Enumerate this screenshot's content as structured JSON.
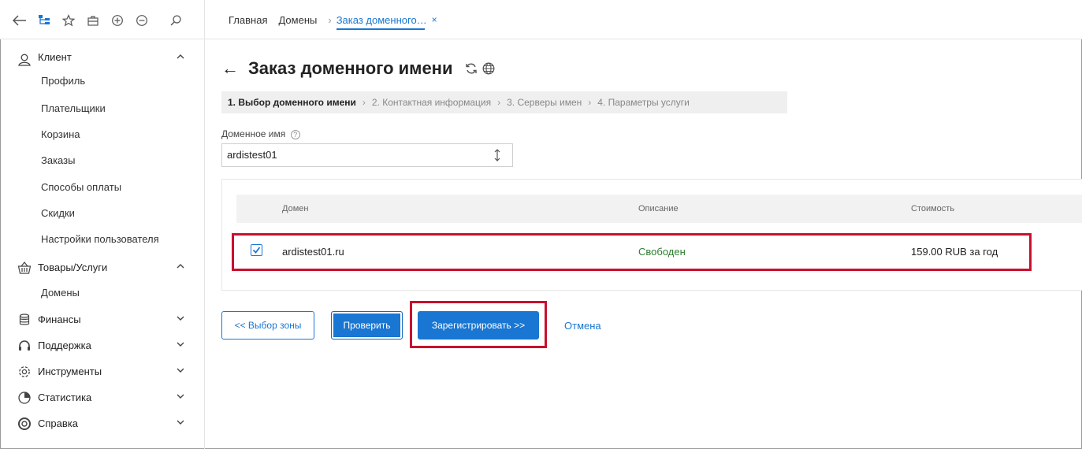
{
  "topbar": {
    "icons": [
      "back-arrow-icon",
      "tree-icon",
      "star-icon",
      "briefcase-icon",
      "zoom-in-icon",
      "zoom-out-icon",
      "search-icon"
    ],
    "tabs": [
      {
        "label": "Главная"
      },
      {
        "label": "Домены"
      },
      {
        "label": "Заказ доменного…",
        "active": true
      }
    ],
    "crumb_separator": "›",
    "close_glyph": "×"
  },
  "sidebar": {
    "groups": [
      {
        "label": "Клиент",
        "icon": "user-icon",
        "expanded": true,
        "items": [
          "Профиль",
          "Плательщики",
          "Корзина",
          "Заказы",
          "Способы оплаты",
          "Скидки",
          "Настройки пользователя"
        ]
      },
      {
        "label": "Товары/Услуги",
        "icon": "basket-icon",
        "expanded": true,
        "items": [
          "Домены"
        ]
      },
      {
        "label": "Финансы",
        "icon": "coins-icon",
        "expanded": false
      },
      {
        "label": "Поддержка",
        "icon": "headset-icon",
        "expanded": false
      },
      {
        "label": "Инструменты",
        "icon": "gear-icon",
        "expanded": false
      },
      {
        "label": "Статистика",
        "icon": "pie-chart-icon",
        "expanded": false
      },
      {
        "label": "Справка",
        "icon": "lifebuoy-icon",
        "expanded": false
      }
    ]
  },
  "main": {
    "title": "Заказ доменного имени",
    "back_glyph": "←",
    "steps": [
      {
        "label": "1. Выбор доменного имени",
        "current": true
      },
      {
        "label": "2. Контактная информация"
      },
      {
        "label": "3. Серверы имен"
      },
      {
        "label": "4. Параметры услуги"
      }
    ],
    "step_separator": "›",
    "field_label": "Доменное имя",
    "help_glyph": "?",
    "domain_value": "ardistest01",
    "table": {
      "columns": [
        "Домен",
        "Описание",
        "Стоимость"
      ],
      "rows": [
        {
          "checked": true,
          "domain": "ardistest01.ru",
          "description": "Свободен",
          "price": "159.00 RUB за год"
        }
      ]
    },
    "buttons": {
      "zone": "<< Выбор зоны",
      "check": "Проверить",
      "register": "Зарегистрировать >>",
      "cancel": "Отмена"
    }
  },
  "colors": {
    "accent": "#1976d2",
    "highlight": "#c8102e",
    "status_free": "#2e7d32"
  }
}
